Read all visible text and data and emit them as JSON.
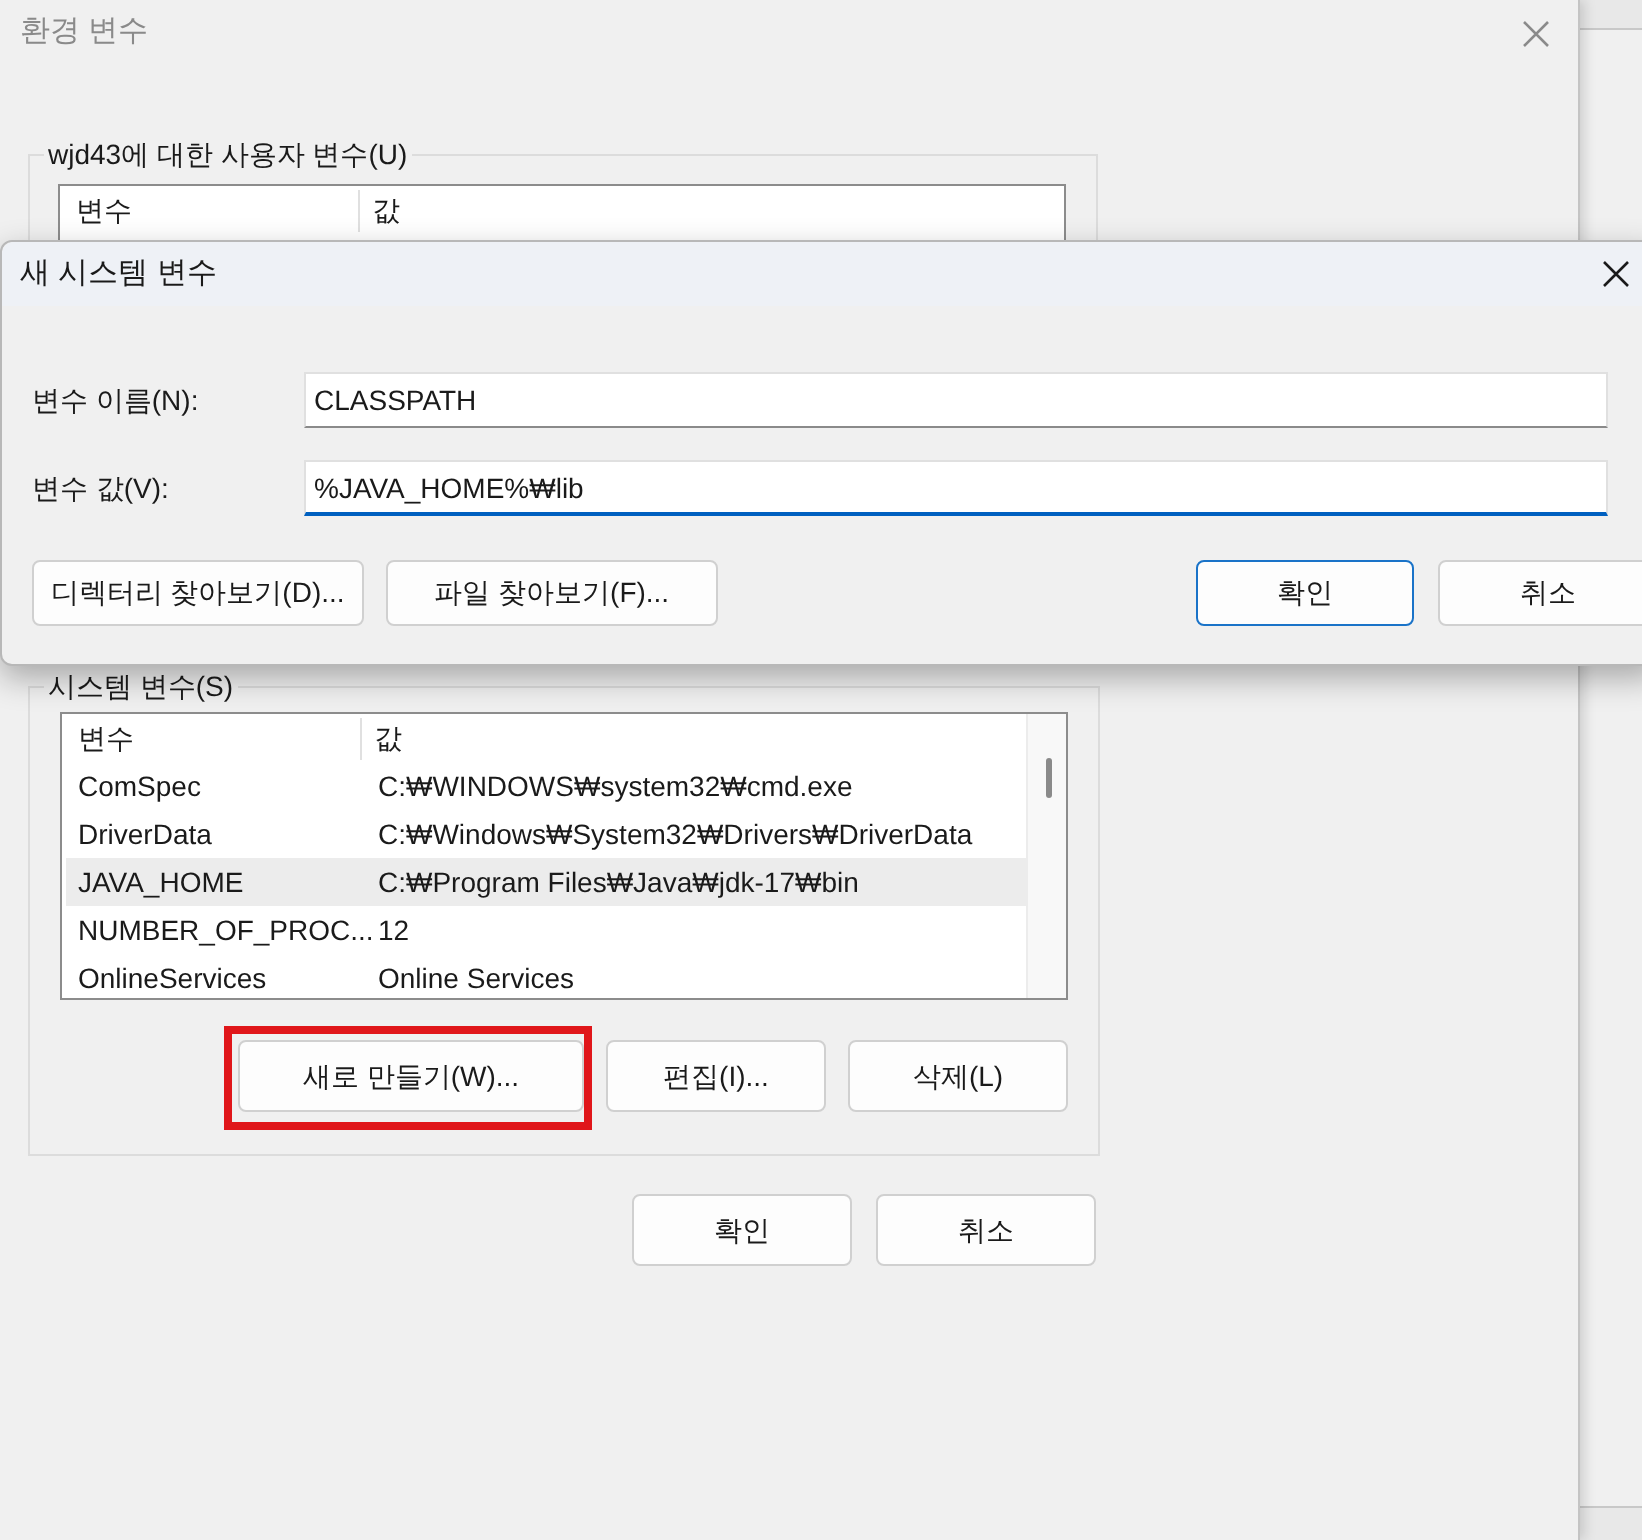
{
  "window": {
    "title": "환경 변수"
  },
  "user_variables": {
    "label": "wjd43에 대한 사용자 변수(U)",
    "columns": [
      "변수",
      "값"
    ]
  },
  "system_variables": {
    "label": "시스템 변수(S)",
    "columns": [
      "변수",
      "값"
    ],
    "rows": [
      {
        "name": "ComSpec",
        "value": "C:₩WINDOWS₩system32₩cmd.exe",
        "selected": false
      },
      {
        "name": "DriverData",
        "value": "C:₩Windows₩System32₩Drivers₩DriverData",
        "selected": false
      },
      {
        "name": "JAVA_HOME",
        "value": "C:₩Program Files₩Java₩jdk-17₩bin",
        "selected": true
      },
      {
        "name": "NUMBER_OF_PROC...",
        "value": "12",
        "selected": false
      },
      {
        "name": "OnlineServices",
        "value": "Online Services",
        "selected": false
      }
    ],
    "buttons": [
      {
        "label": "새로 만들기(W)...",
        "highlighted": true
      },
      {
        "label": "편집(I)...",
        "highlighted": false
      },
      {
        "label": "삭제(L)",
        "highlighted": false
      }
    ]
  },
  "footer_buttons": [
    "확인",
    "취소"
  ],
  "dialog": {
    "title": "새 시스템 변수",
    "fields": [
      {
        "label": "변수 이름(N):",
        "value": "CLASSPATH",
        "focused": false
      },
      {
        "label": "변수 값(V):",
        "value": "%JAVA_HOME%₩lib",
        "focused": true
      }
    ],
    "browse_buttons": [
      "디렉터리 찾아보기(D)...",
      "파일 찾아보기(F)..."
    ],
    "buttons": [
      {
        "label": "확인",
        "default": true
      },
      {
        "label": "취소",
        "default": false
      }
    ]
  }
}
